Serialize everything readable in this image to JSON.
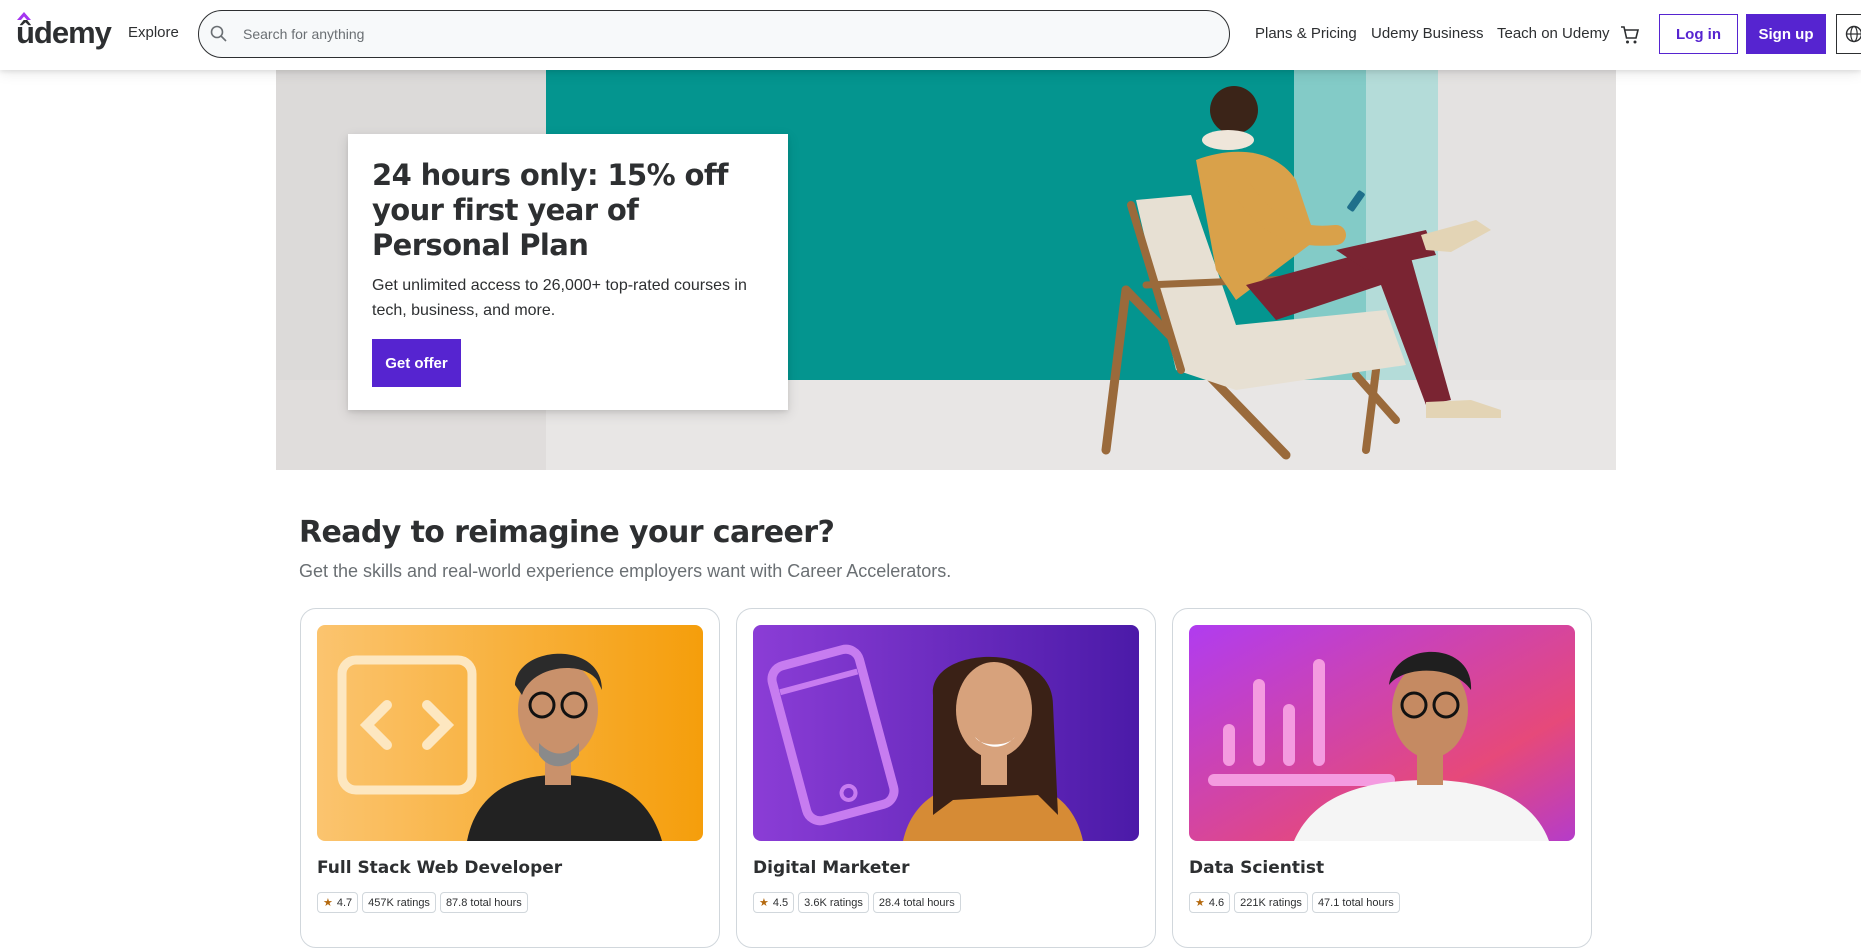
{
  "header": {
    "logo": "ûdemy",
    "explore": "Explore",
    "search_placeholder": "Search for anything",
    "nav": [
      "Plans & Pricing",
      "Udemy Business",
      "Teach on Udemy"
    ],
    "login": "Log in",
    "signup": "Sign up"
  },
  "hero": {
    "title": "24 hours only: 15% off your first year of Personal Plan",
    "subtitle": "Get unlimited access to 26,000+ top-rated courses in tech, business, and more.",
    "cta": "Get offer"
  },
  "career": {
    "title": "Ready to reimagine your career?",
    "subtitle": "Get the skills and real-world experience employers want with Career Accelerators.",
    "cards": [
      {
        "name": "Full Stack Web Developer",
        "rating": "4.7",
        "ratings": "457K ratings",
        "hours": "87.8 total hours",
        "icon": "code-icon"
      },
      {
        "name": "Digital Marketer",
        "rating": "4.5",
        "ratings": "3.6K ratings",
        "hours": "28.4 total hours",
        "icon": "phone-icon"
      },
      {
        "name": "Data Scientist",
        "rating": "4.6",
        "ratings": "221K ratings",
        "hours": "47.1 total hours",
        "icon": "bar-chart-icon"
      }
    ]
  },
  "colors": {
    "brand": "#5624d0",
    "text": "#2d2f31",
    "muted": "#6a6f73",
    "star": "#b4690e"
  }
}
